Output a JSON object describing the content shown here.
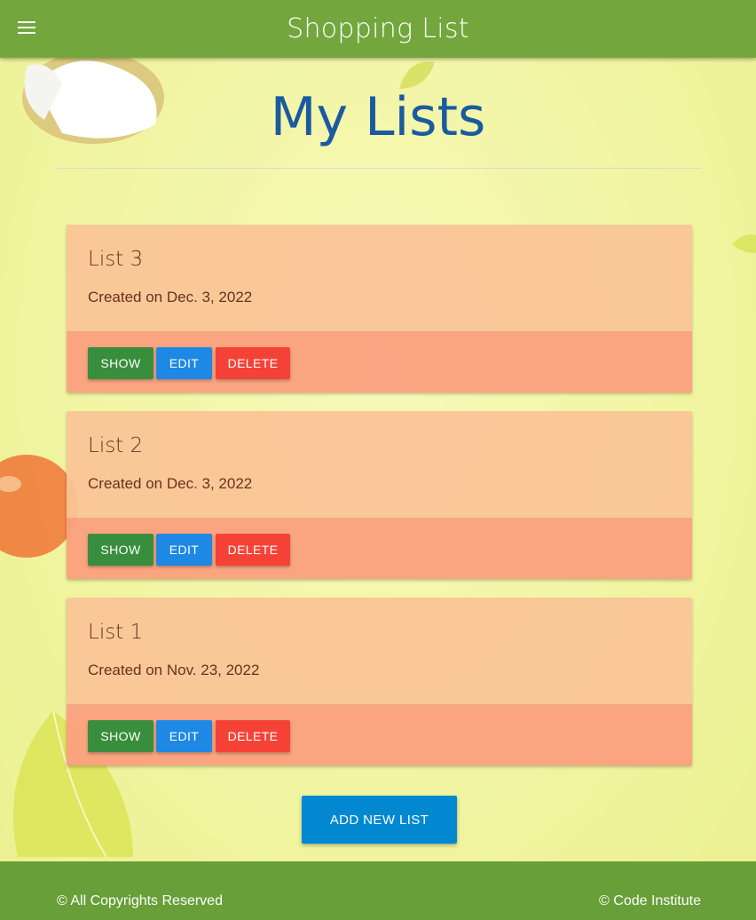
{
  "navbar": {
    "brand": "Shopping List",
    "menu_icon": "hamburger-menu-icon"
  },
  "page": {
    "title": "My Lists"
  },
  "lists": [
    {
      "title": "List 3",
      "created": "Created on Dec. 3, 2022",
      "show_label": "SHOW",
      "edit_label": "EDIT",
      "delete_label": "DELETE"
    },
    {
      "title": "List 2",
      "created": "Created on Dec. 3, 2022",
      "show_label": "SHOW",
      "edit_label": "EDIT",
      "delete_label": "DELETE"
    },
    {
      "title": "List 1",
      "created": "Created on Nov. 23, 2022",
      "show_label": "SHOW",
      "edit_label": "EDIT",
      "delete_label": "DELETE"
    }
  ],
  "actions": {
    "add_new_list": "ADD NEW LIST"
  },
  "footer": {
    "left": "© All Copyrights Reserved",
    "right": "© Code Institute"
  },
  "colors": {
    "navbar": "#73a73d",
    "footer": "#689f38",
    "title": "#1b5aa0",
    "show": "#388e3c",
    "edit": "#1e88e5",
    "delete": "#f44336",
    "add": "#0288d1"
  }
}
